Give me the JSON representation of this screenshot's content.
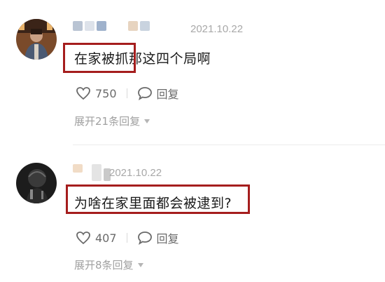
{
  "comments": [
    {
      "date": "2021.10.22",
      "text": "在家被抓那这四个局啊",
      "likes": "750",
      "reply_label": "回复",
      "expand_label": "展开21条回复",
      "name_blur_colors": [
        "#b9c4d3",
        "#dde2ea",
        "#9fb2cc",
        "#e7d4c0",
        "#c9d3df"
      ]
    },
    {
      "date": "2021.10.22",
      "text": "为啥在家里面都会被逮到?",
      "likes": "407",
      "reply_label": "回复",
      "expand_label": "展开8条回复",
      "name_blur_colors": [
        "#f1dcc6",
        "#e4e4e4",
        "#c9c9c9"
      ]
    }
  ],
  "colors": {
    "highlight": "#a51d1d",
    "text": "#1a1a1a",
    "meta": "#a8a8a8"
  },
  "icons": {
    "like": "heart-outline-icon",
    "reply": "speech-bubble-icon",
    "expand": "caret-down-icon"
  }
}
